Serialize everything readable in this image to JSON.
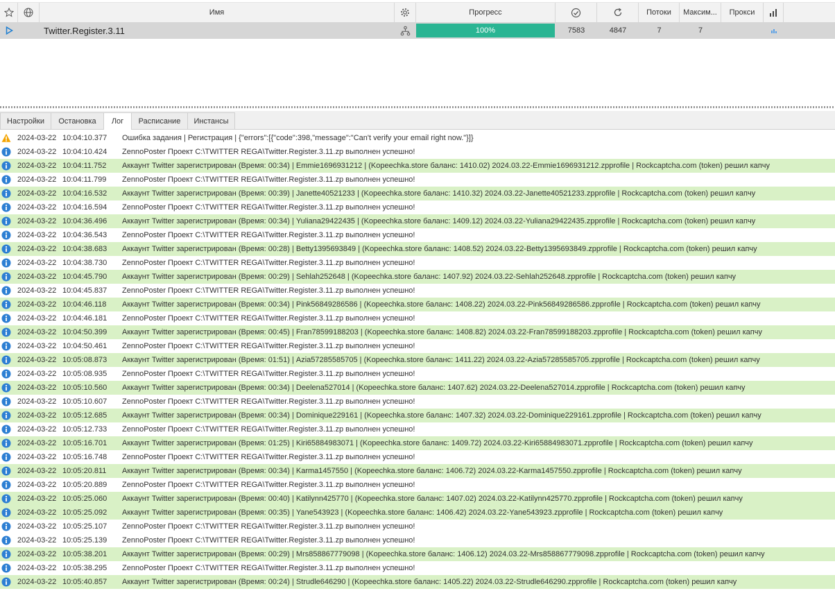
{
  "grid": {
    "columns": {
      "name": "Имя",
      "progress": "Прогресс",
      "threads": "Потоки",
      "max": "Максим...",
      "proxy": "Прокси"
    },
    "task": {
      "name": "Twitter.Register.3.11",
      "progress_percent": 100,
      "progress_label": "100%",
      "success_count": "7583",
      "attempts_count": "4847",
      "threads": "7",
      "max_threads": "7"
    }
  },
  "tabs": [
    {
      "label": "Настройки"
    },
    {
      "label": "Остановка"
    },
    {
      "label": "Лог"
    },
    {
      "label": "Расписание"
    },
    {
      "label": "Инстансы"
    }
  ],
  "active_tab": "Лог",
  "colors": {
    "progress": "#2ab593",
    "success_row": "#d9f1c6",
    "info_icon": "#2d7fd3",
    "warning_icon": "#f4a400"
  },
  "log": [
    {
      "type": "warning",
      "date": "2024-03-22",
      "time": "10:04:10.377",
      "message": "Ошибка задания | Регистрация | {\"errors\":[{\"code\":398,\"message\":\"Can't verify your email right now.\"}]}"
    },
    {
      "type": "info",
      "date": "2024-03-22",
      "time": "10:04:10.424",
      "message": "ZennoPoster Проект C:\\TWITTER REGA\\Twitter.Register.3.11.zp выполнен успешно!"
    },
    {
      "type": "success",
      "date": "2024-03-22",
      "time": "10:04:11.752",
      "message": "Аккаунт Twitter зарегистрирован (Время: 00:34) | Emmie1696931212 | (Kopeechka.store баланс: 1410.02) 2024.03.22-Emmie1696931212.zpprofile | Rockcaptcha.com (token) решил капчу"
    },
    {
      "type": "info",
      "date": "2024-03-22",
      "time": "10:04:11.799",
      "message": "ZennoPoster Проект C:\\TWITTER REGA\\Twitter.Register.3.11.zp выполнен успешно!"
    },
    {
      "type": "success",
      "date": "2024-03-22",
      "time": "10:04:16.532",
      "message": "Аккаунт Twitter зарегистрирован (Время: 00:39) | Janette40521233 | (Kopeechka.store баланс: 1410.32) 2024.03.22-Janette40521233.zpprofile | Rockcaptcha.com (token) решил капчу"
    },
    {
      "type": "info",
      "date": "2024-03-22",
      "time": "10:04:16.594",
      "message": "ZennoPoster Проект C:\\TWITTER REGA\\Twitter.Register.3.11.zp выполнен успешно!"
    },
    {
      "type": "success",
      "date": "2024-03-22",
      "time": "10:04:36.496",
      "message": "Аккаунт Twitter зарегистрирован (Время: 00:34) | Yuliana29422435 | (Kopeechka.store баланс: 1409.12) 2024.03.22-Yuliana29422435.zpprofile | Rockcaptcha.com (token) решил капчу"
    },
    {
      "type": "info",
      "date": "2024-03-22",
      "time": "10:04:36.543",
      "message": "ZennoPoster Проект C:\\TWITTER REGA\\Twitter.Register.3.11.zp выполнен успешно!"
    },
    {
      "type": "success",
      "date": "2024-03-22",
      "time": "10:04:38.683",
      "message": "Аккаунт Twitter зарегистрирован (Время: 00:28) | Betty1395693849 | (Kopeechka.store баланс: 1408.52) 2024.03.22-Betty1395693849.zpprofile | Rockcaptcha.com (token) решил капчу"
    },
    {
      "type": "info",
      "date": "2024-03-22",
      "time": "10:04:38.730",
      "message": "ZennoPoster Проект C:\\TWITTER REGA\\Twitter.Register.3.11.zp выполнен успешно!"
    },
    {
      "type": "success",
      "date": "2024-03-22",
      "time": "10:04:45.790",
      "message": "Аккаунт Twitter зарегистрирован (Время: 00:29) | Sehlah252648 | (Kopeechka.store баланс: 1407.92) 2024.03.22-Sehlah252648.zpprofile | Rockcaptcha.com (token) решил капчу"
    },
    {
      "type": "info",
      "date": "2024-03-22",
      "time": "10:04:45.837",
      "message": "ZennoPoster Проект C:\\TWITTER REGA\\Twitter.Register.3.11.zp выполнен успешно!"
    },
    {
      "type": "success",
      "date": "2024-03-22",
      "time": "10:04:46.118",
      "message": "Аккаунт Twitter зарегистрирован (Время: 00:34) | Pink56849286586 | (Kopeechka.store баланс: 1408.22) 2024.03.22-Pink56849286586.zpprofile | Rockcaptcha.com (token) решил капчу"
    },
    {
      "type": "info",
      "date": "2024-03-22",
      "time": "10:04:46.181",
      "message": "ZennoPoster Проект C:\\TWITTER REGA\\Twitter.Register.3.11.zp выполнен успешно!"
    },
    {
      "type": "success",
      "date": "2024-03-22",
      "time": "10:04:50.399",
      "message": "Аккаунт Twitter зарегистрирован (Время: 00:45) | Fran78599188203 | (Kopeechka.store баланс: 1408.82) 2024.03.22-Fran78599188203.zpprofile | Rockcaptcha.com (token) решил капчу"
    },
    {
      "type": "info",
      "date": "2024-03-22",
      "time": "10:04:50.461",
      "message": "ZennoPoster Проект C:\\TWITTER REGA\\Twitter.Register.3.11.zp выполнен успешно!"
    },
    {
      "type": "success",
      "date": "2024-03-22",
      "time": "10:05:08.873",
      "message": "Аккаунт Twitter зарегистрирован (Время: 01:51) | Azia57285585705 | (Kopeechka.store баланс: 1411.22) 2024.03.22-Azia57285585705.zpprofile | Rockcaptcha.com (token) решил капчу"
    },
    {
      "type": "info",
      "date": "2024-03-22",
      "time": "10:05:08.935",
      "message": "ZennoPoster Проект C:\\TWITTER REGA\\Twitter.Register.3.11.zp выполнен успешно!"
    },
    {
      "type": "success",
      "date": "2024-03-22",
      "time": "10:05:10.560",
      "message": "Аккаунт Twitter зарегистрирован (Время: 00:34) | Deelena527014 | (Kopeechka.store баланс: 1407.62) 2024.03.22-Deelena527014.zpprofile | Rockcaptcha.com (token) решил капчу"
    },
    {
      "type": "info",
      "date": "2024-03-22",
      "time": "10:05:10.607",
      "message": "ZennoPoster Проект C:\\TWITTER REGA\\Twitter.Register.3.11.zp выполнен успешно!"
    },
    {
      "type": "success",
      "date": "2024-03-22",
      "time": "10:05:12.685",
      "message": "Аккаунт Twitter зарегистрирован (Время: 00:34) | Dominique229161 | (Kopeechka.store баланс: 1407.32) 2024.03.22-Dominique229161.zpprofile | Rockcaptcha.com (token) решил капчу"
    },
    {
      "type": "info",
      "date": "2024-03-22",
      "time": "10:05:12.733",
      "message": "ZennoPoster Проект C:\\TWITTER REGA\\Twitter.Register.3.11.zp выполнен успешно!"
    },
    {
      "type": "success",
      "date": "2024-03-22",
      "time": "10:05:16.701",
      "message": "Аккаунт Twitter зарегистрирован (Время: 01:25) | Kiri65884983071 | (Kopeechka.store баланс: 1409.72) 2024.03.22-Kiri65884983071.zpprofile | Rockcaptcha.com (token) решил капчу"
    },
    {
      "type": "info",
      "date": "2024-03-22",
      "time": "10:05:16.748",
      "message": "ZennoPoster Проект C:\\TWITTER REGA\\Twitter.Register.3.11.zp выполнен успешно!"
    },
    {
      "type": "success",
      "date": "2024-03-22",
      "time": "10:05:20.811",
      "message": "Аккаунт Twitter зарегистрирован (Время: 00:34) | Karma1457550 | (Kopeechka.store баланс: 1406.72) 2024.03.22-Karma1457550.zpprofile | Rockcaptcha.com (token) решил капчу"
    },
    {
      "type": "info",
      "date": "2024-03-22",
      "time": "10:05:20.889",
      "message": "ZennoPoster Проект C:\\TWITTER REGA\\Twitter.Register.3.11.zp выполнен успешно!"
    },
    {
      "type": "success",
      "date": "2024-03-22",
      "time": "10:05:25.060",
      "message": "Аккаунт Twitter зарегистрирован (Время: 00:40) | Katilynn425770 | (Kopeechka.store баланс: 1407.02) 2024.03.22-Katilynn425770.zpprofile | Rockcaptcha.com (token) решил капчу"
    },
    {
      "type": "success",
      "date": "2024-03-22",
      "time": "10:05:25.092",
      "message": "Аккаунт Twitter зарегистрирован (Время: 00:35) | Yane543923 | (Kopeechka.store баланс: 1406.42) 2024.03.22-Yane543923.zpprofile | Rockcaptcha.com (token) решил капчу"
    },
    {
      "type": "info",
      "date": "2024-03-22",
      "time": "10:05:25.107",
      "message": "ZennoPoster Проект C:\\TWITTER REGA\\Twitter.Register.3.11.zp выполнен успешно!"
    },
    {
      "type": "info",
      "date": "2024-03-22",
      "time": "10:05:25.139",
      "message": "ZennoPoster Проект C:\\TWITTER REGA\\Twitter.Register.3.11.zp выполнен успешно!"
    },
    {
      "type": "success",
      "date": "2024-03-22",
      "time": "10:05:38.201",
      "message": "Аккаунт Twitter зарегистрирован (Время: 00:29) | Mrs858867779098 | (Kopeechka.store баланс: 1406.12) 2024.03.22-Mrs858867779098.zpprofile | Rockcaptcha.com (token) решил капчу"
    },
    {
      "type": "info",
      "date": "2024-03-22",
      "time": "10:05:38.295",
      "message": "ZennoPoster Проект C:\\TWITTER REGA\\Twitter.Register.3.11.zp выполнен успешно!"
    },
    {
      "type": "success",
      "date": "2024-03-22",
      "time": "10:05:40.857",
      "message": "Аккаунт Twitter зарегистрирован (Время: 00:24) | Strudle646290 | (Kopeechka.store баланс: 1405.22) 2024.03.22-Strudle646290.zpprofile | Rockcaptcha.com (token) решил капчу"
    }
  ]
}
